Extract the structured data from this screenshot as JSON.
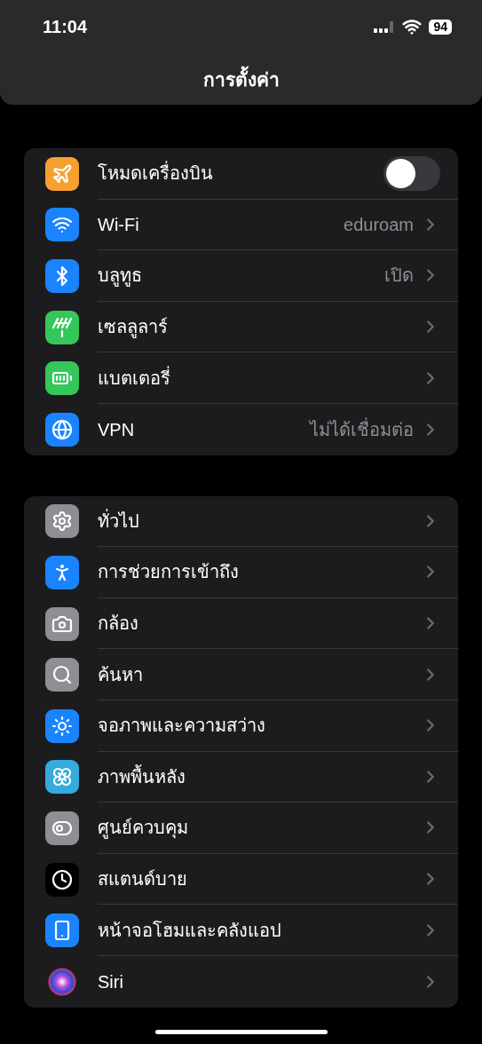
{
  "status_bar": {
    "time": "11:04",
    "battery": "94"
  },
  "title": "การตั้งค่า",
  "sections": [
    {
      "rows": [
        {
          "kind": "toggle",
          "label": "โหมดเครื่องบิน",
          "on": false,
          "color": "#f7a030"
        },
        {
          "kind": "link",
          "label": "Wi-Fi",
          "value": "eduroam",
          "color": "#1a84ff"
        },
        {
          "kind": "link",
          "label": "บลูทูธ",
          "value": "เปิด",
          "color": "#1a84ff"
        },
        {
          "kind": "link",
          "label": "เซลลูลาร์",
          "color": "#34c759"
        },
        {
          "kind": "link",
          "label": "แบตเตอรี่",
          "color": "#34c759"
        },
        {
          "kind": "link",
          "label": "VPN",
          "value": "ไม่ได้เชื่อมต่อ",
          "color": "#1a84ff"
        }
      ]
    },
    {
      "rows": [
        {
          "kind": "link",
          "label": "ทั่วไป",
          "color": "#8e8e93"
        },
        {
          "kind": "link",
          "label": "การช่วยการเข้าถึง",
          "color": "#1a84ff"
        },
        {
          "kind": "link",
          "label": "กล้อง",
          "color": "#8e8e93"
        },
        {
          "kind": "link",
          "label": "ค้นหา",
          "color": "#8e8e93"
        },
        {
          "kind": "link",
          "label": "จอภาพและความสว่าง",
          "color": "#1a84ff"
        },
        {
          "kind": "link",
          "label": "ภาพพื้นหลัง",
          "color": "#35aadc"
        },
        {
          "kind": "link",
          "label": "ศูนย์ควบคุม",
          "color": "#8e8e93"
        },
        {
          "kind": "link",
          "label": "สแตนด์บาย",
          "color": "#000000"
        },
        {
          "kind": "link",
          "label": "หน้าจอโฮมและคลังแอป",
          "color": "#1a84ff"
        },
        {
          "kind": "link",
          "label": "Siri"
        }
      ]
    }
  ]
}
